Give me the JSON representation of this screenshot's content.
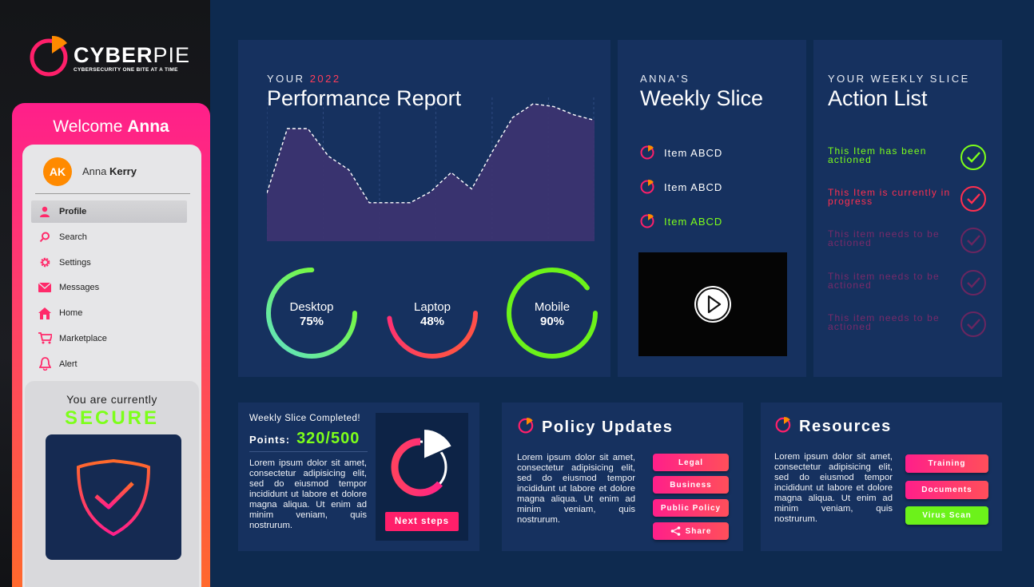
{
  "brand": {
    "name_bold": "CYBER",
    "name_light": "PIE",
    "tagline": "CYBERSECURITY ONE BITE AT A TIME",
    "accent": "#ff1f8a",
    "accent2": "#ff6a2a",
    "success": "#7dff1a"
  },
  "sidebar": {
    "welcome_prefix": "Welcome",
    "welcome_name": "Anna",
    "avatar_initials": "AK",
    "user_first": "Anna",
    "user_last": "Kerry",
    "items": [
      {
        "label": "Profile",
        "icon": "user-icon"
      },
      {
        "label": "Search",
        "icon": "search-icon"
      },
      {
        "label": "Settings",
        "icon": "gear-icon"
      },
      {
        "label": "Messages",
        "icon": "envelope-icon"
      },
      {
        "label": "Home",
        "icon": "home-icon"
      },
      {
        "label": "Marketplace",
        "icon": "cart-icon"
      },
      {
        "label": "Alert",
        "icon": "bell-icon"
      }
    ],
    "status_line1": "You are currently",
    "status_line2": "SECURE"
  },
  "performance": {
    "eyebrow_prefix": "YOUR",
    "eyebrow_year": "2022",
    "title": "Performance Report",
    "chart_data": {
      "type": "area",
      "title": "",
      "values": [
        35,
        82,
        82,
        62,
        52,
        28,
        28,
        28,
        36,
        50,
        38,
        65,
        90,
        100,
        98,
        92,
        88
      ],
      "grid": true
    },
    "donuts": [
      {
        "label": "Desktop",
        "value_text": "75%",
        "value": 0.75,
        "color": "green-gradient"
      },
      {
        "label": "Laptop",
        "value_text": "48%",
        "value": 0.48,
        "color": "pink-gradient"
      },
      {
        "label": "Mobile",
        "value_text": "90%",
        "value": 0.9,
        "color": "#6cf21a"
      }
    ]
  },
  "weekly_slice": {
    "eyebrow": "ANNA'S",
    "title": "Weekly Slice",
    "items": [
      {
        "label": "Item ABCD",
        "color": "#ffffff"
      },
      {
        "label": "Item ABCD",
        "color": "#ffffff"
      },
      {
        "label": "Item ABCD",
        "color": "#7dff1a"
      }
    ]
  },
  "actions": {
    "eyebrow": "YOUR WEEKLY SLICE",
    "title": "Action List",
    "items": [
      {
        "text": "This Item has been actioned",
        "color": "#7dff1a"
      },
      {
        "text": "This Item is currently in progress",
        "color": "#ff2f4f"
      },
      {
        "text": "This item needs to be actioned",
        "color": "#7a2a6a"
      },
      {
        "text": "This item needs to be actioned",
        "color": "#7a2a6a"
      },
      {
        "text": "This item needs to be actioned",
        "color": "#7a2a6a"
      }
    ]
  },
  "points": {
    "heading": "Weekly Slice Completed!",
    "label": "Points:",
    "value": "320/500",
    "progress": 0.64,
    "body": "Lorem ipsum dolor sit amet, consectetur adipisicing elit, sed do eiusmod tempor incididunt ut labore et dolore magna aliqua. Ut enim ad minim veniam, quis nostrurum.",
    "button": "Next steps"
  },
  "policy": {
    "title": "Policy Updates",
    "body": "Lorem ipsum dolor sit amet, consectetur adipisicing elit, sed do eiusmod tempor incididunt ut labore et dolore magna aliqua. Ut enim ad minim veniam, quis nostrurum.",
    "buttons": [
      "Legal",
      "Business",
      "Public Policy",
      "Share"
    ]
  },
  "resources": {
    "title": "Resources",
    "body": "Lorem ipsum dolor sit amet, consectetur adipisicing elit, sed do eiusmod tempor incididunt ut labore et dolore magna aliqua. Ut enim ad minim veniam, quis nostrurum.",
    "buttons": [
      "Training",
      "Documents",
      "Virus Scan"
    ]
  }
}
